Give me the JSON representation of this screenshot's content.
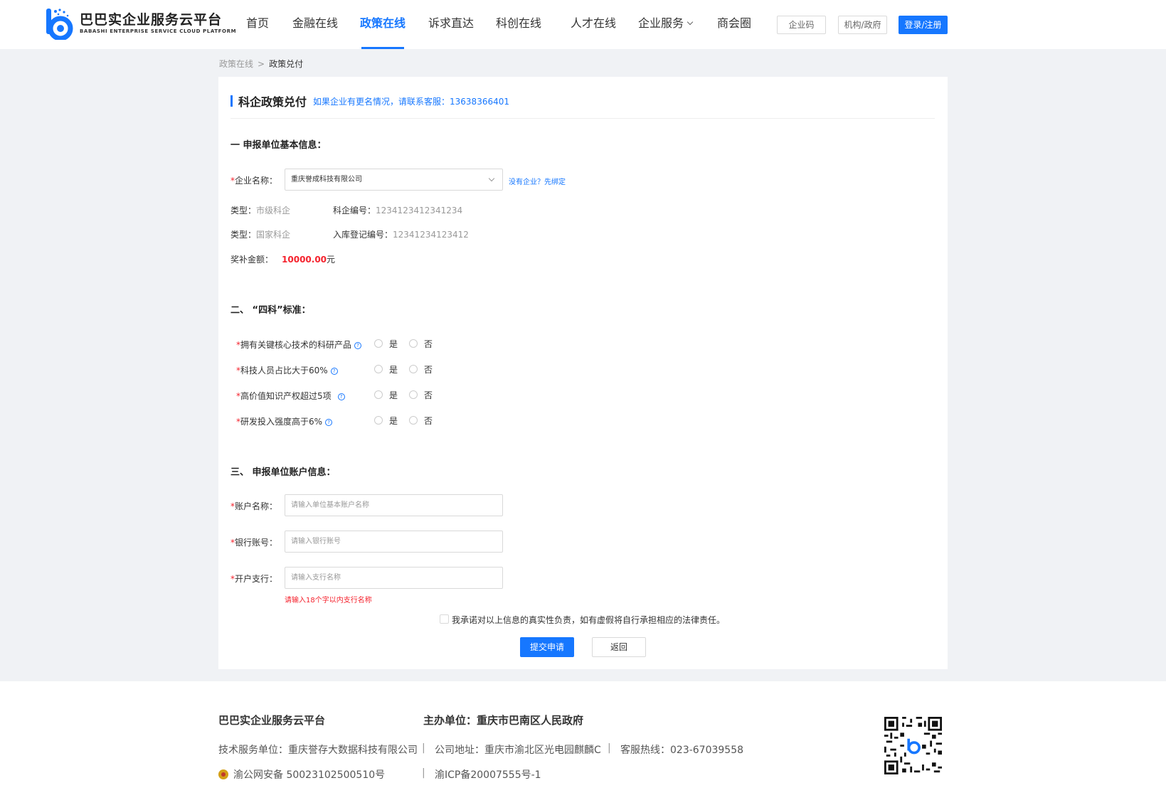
{
  "header": {
    "logo_cn": "巴巴实企业服务云平台",
    "logo_en": "BABASHI ENTERPRISE SERVICE CLOUD PLATFORM",
    "nav": [
      "首页",
      "金融在线",
      "政策在线",
      "诉求直达",
      "科创在线",
      "人才在线",
      "企业服务",
      "商会圈"
    ],
    "active_nav": "政策在线",
    "btn_enterprise_code": "企业码",
    "btn_org": "机构/政府",
    "btn_login": "登录/注册",
    "accent_color": "#1677ff"
  },
  "breadcrumb": {
    "parent": "政策在线",
    "sep": ">",
    "current": "政策兑付"
  },
  "form": {
    "title": "科企政策兑付",
    "hint": "如果企业有更名情况，请联系客服：13638366401",
    "section1": "一 申报单位基本信息：",
    "company_label": "企业名称：",
    "company_value": "重庆誉成科技有限公司",
    "no_company_link": "没有企业？先绑定",
    "type1_label": "类型：",
    "type1_value": "市级科企",
    "code1_label": "科企编号：",
    "code1_value": "1234123412341234",
    "type2_label": "类型：",
    "type2_value": "国家科企",
    "code2_label": "入库登记编号：",
    "code2_value": "12341234123412",
    "amount_label": "奖补金额：",
    "amount_value": "10000.00",
    "amount_unit": "元",
    "section2": "二、 “四科”标准：",
    "criteria": [
      {
        "label": "拥有关键核心技术的科研产品"
      },
      {
        "label": "科技人员占比大于60%"
      },
      {
        "label": "高价值知识产权超过5项"
      },
      {
        "label": "研发投入强度高于6%"
      }
    ],
    "yes": "是",
    "no": "否",
    "help_glyph": "?",
    "req_mark": "*",
    "section3": "三、 申报单位账户信息：",
    "account_label": "账户名称：",
    "account_placeholder": "请输入单位基本账户名称",
    "bank_label": "银行账号：",
    "bank_placeholder": "请输入银行账号",
    "branch_label": "开户支行：",
    "branch_placeholder": "请输入支行名称",
    "branch_error": "请输入18个字以内支行名称",
    "promise": "我承诺对以上信息的真实性负责，如有虚假将自行承担相应的法律责任。",
    "submit": "提交申请",
    "back": "返回"
  },
  "footer": {
    "platform": "巴巴实企业服务云平台",
    "host": "主办单位：重庆市巴南区人民政府",
    "tech": "技术服务单位：重庆誉存大数据科技有限公司",
    "address": "公司地址：重庆市渝北区光电园麒麟C",
    "hotline": "客服热线：023-67039558",
    "police": "渝公网安备 50023102500510号",
    "icp": "渝ICP备20007555号-1",
    "sep": "|"
  }
}
